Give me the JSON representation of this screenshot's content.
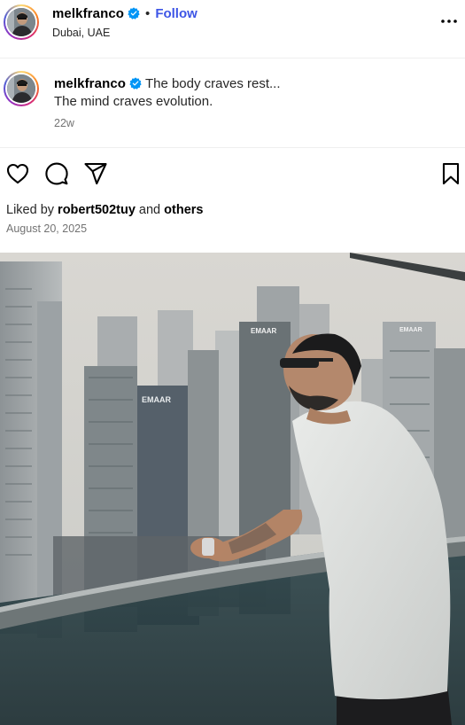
{
  "post": {
    "username": "melkfranco",
    "verified_icon": "verified-badge-icon",
    "separator": "•",
    "follow_label": "Follow",
    "location": "Dubai, UAE",
    "more_icon": "more-options-icon"
  },
  "caption": {
    "username": "melkfranco",
    "text_line1": "The body craves rest...",
    "text_line2": "The mind craves evolution.",
    "time_ago": "22w"
  },
  "actions": {
    "like_icon": "heart-icon",
    "comment_icon": "comment-icon",
    "share_icon": "share-icon",
    "save_icon": "bookmark-icon"
  },
  "likes": {
    "prefix": "Liked by",
    "user": "robert502tuy",
    "joiner": "and",
    "others": "others"
  },
  "date": "August 20, 2025",
  "photo": {
    "description_icon": "post-photo",
    "building_signs": [
      "EMAAR",
      "EMAAR",
      "EMAAR"
    ]
  },
  "colors": {
    "accent": "#3d55e6",
    "verified": "#0095f6",
    "secondary_text": "#737373"
  }
}
